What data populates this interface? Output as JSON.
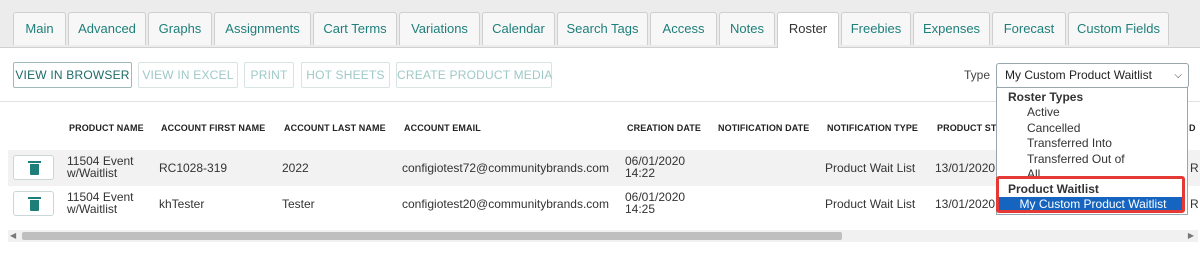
{
  "tabs": [
    {
      "label": "Main"
    },
    {
      "label": "Advanced"
    },
    {
      "label": "Graphs"
    },
    {
      "label": "Assignments"
    },
    {
      "label": "Cart Terms"
    },
    {
      "label": "Variations"
    },
    {
      "label": "Calendar"
    },
    {
      "label": "Search Tags"
    },
    {
      "label": "Access"
    },
    {
      "label": "Notes"
    },
    {
      "label": "Roster"
    },
    {
      "label": "Freebies"
    },
    {
      "label": "Expenses"
    },
    {
      "label": "Forecast"
    },
    {
      "label": "Custom Fields"
    }
  ],
  "active_tab": "Roster",
  "toolbar": {
    "view_in_browser": "VIEW IN BROWSER",
    "view_in_excel": "VIEW IN EXCEL",
    "print": "PRINT",
    "hot_sheets": "HOT SHEETS",
    "create_product_media": "CREATE PRODUCT MEDIA",
    "type_label": "Type",
    "type_value": "My Custom Product Waitlist"
  },
  "table": {
    "headers": {
      "product_name": "PRODUCT NAME",
      "account_first_name": "ACCOUNT FIRST NAME",
      "account_last_name": "ACCOUNT LAST NAME",
      "account_email": "ACCOUNT EMAIL",
      "creation_date": "CREATION DATE",
      "notification_date": "NOTIFICATION DATE",
      "notification_type": "NOTIFICATION TYPE",
      "product_status": "PRODUCT ST",
      "extra": "D"
    },
    "rows": [
      {
        "product_line1": "11504 Event",
        "product_line2": "w/Waitlist",
        "first_name": "RC1028-319",
        "last_name": "2022",
        "email": "configiotest72@communitybrands.com",
        "created_date": "06/01/2020",
        "created_time": "14:22",
        "notification_date": "",
        "notification_type": "Product Wait List",
        "status_date": "13/01/2020",
        "extra": "R"
      },
      {
        "product_line1": "11504 Event",
        "product_line2": "w/Waitlist",
        "first_name": "khTester",
        "last_name": "Tester",
        "email": "configiotest20@communitybrands.com",
        "created_date": "06/01/2020",
        "created_time": "14:25",
        "notification_date": "",
        "notification_type": "Product Wait List",
        "status_date": "13/01/2020",
        "extra": "R"
      }
    ]
  },
  "dropdown": {
    "group1": "Roster Types",
    "group1_options": [
      "Active",
      "Cancelled",
      "Transferred Into",
      "Transferred Out of",
      "All"
    ],
    "group2": "Product Waitlist",
    "group2_options": [
      "My Custom Product Waitlist"
    ]
  },
  "colors": {
    "accent": "#1e7f7a",
    "selected": "#1565c0",
    "highlight": "#e53935"
  }
}
